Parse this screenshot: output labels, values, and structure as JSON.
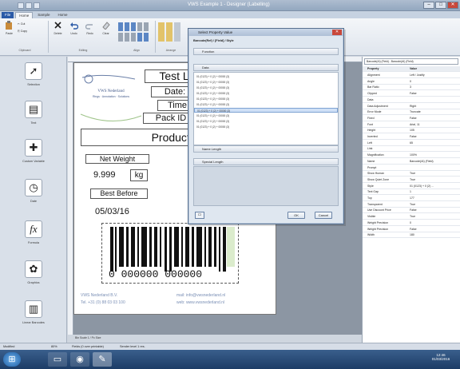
{
  "window": {
    "title": "VWS Example 1 - Designer (Labelling)",
    "min": "–",
    "max": "□",
    "close": "✕"
  },
  "tabs": [
    "File",
    "Home",
    "Sample",
    "Home"
  ],
  "ribbon": {
    "buttons": [
      "Paste",
      "Cut",
      "Copy",
      "Delete",
      "Undo",
      "Redo",
      "Clear",
      "Format"
    ],
    "groups": [
      "Clipboard",
      "Editing",
      "Align",
      "Arrange"
    ]
  },
  "tools": [
    "Selection",
    "Text",
    "Custom Variable",
    "Date",
    "Formula",
    "Graphics",
    "Linear Barcodes"
  ],
  "tool_icons": [
    "arrow-icon",
    "text-icon",
    "puzzle-icon",
    "clock-icon",
    "fx-icon",
    "graphics-icon",
    "barcode-icon"
  ],
  "label": {
    "company_title": "VWS Nederland",
    "company_sub": "Rings · Annotation · Solutions",
    "test": "Test L",
    "date": "Date:",
    "time": "Time",
    "pack_id": "Pack ID",
    "product": "Product T",
    "net_weight": "Net Weight",
    "weight_value": "9.999",
    "weight_unit": "kg",
    "best_before": "Best Before",
    "best_before_date": "05/03/16",
    "barcode_digits": "0  000000  000000",
    "footer_company": "VWS Nederland B.V.",
    "footer_phone": "Tel. +31 (0) 88 03 03 100",
    "footer_mail": "mail: info@vwsnederland.nl",
    "footer_web": "web: www.vwsnederland.nl",
    "bottom_note": "Bin Scale 1 / Pc Size"
  },
  "dialog": {
    "title": "Select Property Value",
    "path": "Barcode(Ref) / [Field] / Style",
    "sections": [
      "Function",
      "Data",
      "Name Length",
      "Special Length"
    ],
    "list": [
      "01 (0123) + 0 (2) + 00000 (3)",
      "01 (0123) + 0 (2) + 00000 (3)",
      "01 (0123) + 0 (2) + 00000 (3)",
      "01 (0123) + 0 (2) + 00000 (3)",
      "01 (0123) + 0 (2) + 00000 (3)",
      "01 (0123) + 0 (2) + 00000 (3)",
      "01 (0123) + 0 (2) + 00000 (3)",
      "01 (0123) + 0 (2) + 00000 (3)",
      "01 (0123) + 0 (2) + 00000 (3)",
      "01 (0123) + 0 (2) + 00000 (3)"
    ],
    "selected_index": 6,
    "ok": "OK",
    "cancel": "Cancel"
  },
  "props": {
    "selector": "Barcode(AI) (Field) - Barcode(AI) (Field)",
    "header": [
      "Property",
      "Value"
    ],
    "rows": [
      [
        "Alignment",
        "Left / Justify"
      ],
      [
        "Angle",
        "0"
      ],
      [
        "Bar Ratio",
        "3"
      ],
      [
        "Clipped",
        "False"
      ],
      [
        "Data",
        ""
      ],
      [
        "Data Adjustment",
        "Right"
      ],
      [
        "Error Mode",
        "Truncate"
      ],
      [
        "Fixed",
        "False"
      ],
      [
        "Font",
        "Arial, 11"
      ],
      [
        "Height",
        "105"
      ],
      [
        "Inverted",
        "False"
      ],
      [
        "Left",
        "65"
      ],
      [
        "Link",
        ""
      ],
      [
        "Magnification",
        "100%"
      ],
      [
        "Name",
        "Barcode(AI) (Field)"
      ],
      [
        "Prompt",
        ""
      ],
      [
        "Show Human",
        "True"
      ],
      [
        "Show Quiet Zone",
        "True"
      ],
      [
        "Style",
        "01 (0123) + 0 (2) ..."
      ],
      [
        "Text Gap",
        "1"
      ],
      [
        "Top",
        "177"
      ],
      [
        "Transparent",
        "True"
      ],
      [
        "Use Discount Price",
        "False"
      ],
      [
        "Visible",
        "True"
      ],
      [
        "Weight Precision",
        "0"
      ],
      [
        "Weight Precision",
        "False"
      ],
      [
        "Width",
        "180"
      ]
    ]
  },
  "status": {
    "mode": "Modified",
    "zoom": "80%",
    "caps": "Fields (0 over printable)",
    "printer": "Sender level 1 res."
  },
  "clock": {
    "time": "12:46",
    "date": "01/03/2016"
  }
}
